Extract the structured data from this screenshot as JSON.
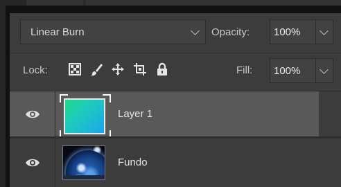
{
  "blend_mode": {
    "value": "Linear Burn"
  },
  "opacity": {
    "label": "Opacity:",
    "value": "100%"
  },
  "lock": {
    "label": "Lock:",
    "icons": [
      "lock-transparent-pixels-icon",
      "lock-image-pixels-icon",
      "lock-position-icon",
      "prevent-autonest-icon",
      "lock-all-icon"
    ]
  },
  "fill": {
    "label": "Fill:",
    "value": "100%"
  },
  "layers": [
    {
      "name": "Layer 1",
      "selected": true,
      "visible": true,
      "thumbnail": "gradient-green-blue"
    },
    {
      "name": "Fundo",
      "selected": false,
      "visible": true,
      "thumbnail": "earth-image"
    }
  ],
  "colors": {
    "panel_bg": "#3c3c3c",
    "selected_row": "#595959",
    "text": "#d6d6d6",
    "gradient_start": "#1edb8b",
    "gradient_end": "#1aa5f0"
  }
}
